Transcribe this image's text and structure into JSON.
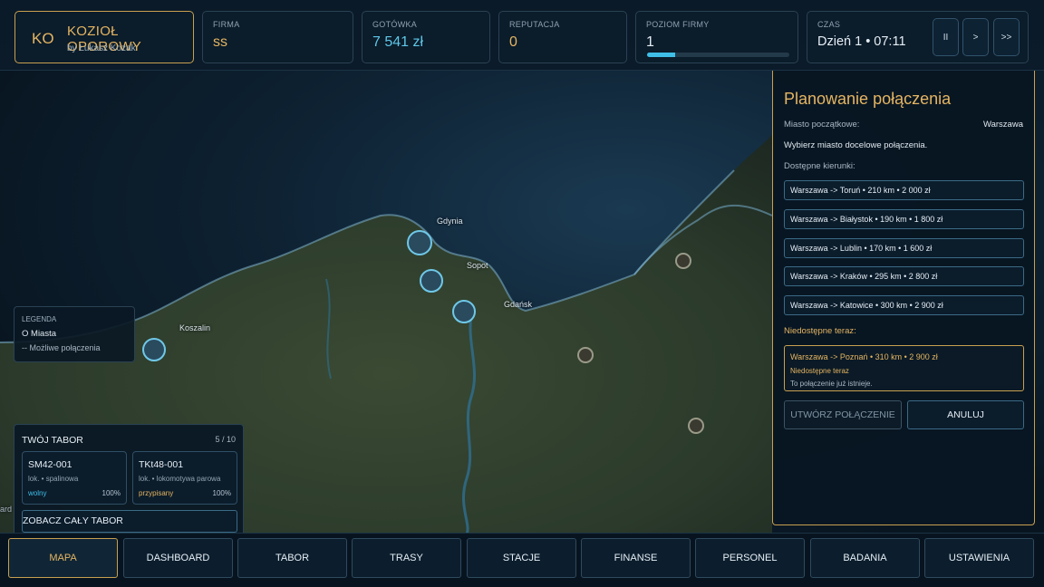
{
  "header": {
    "brand": {
      "initials": "KO",
      "name": "KOZIOŁ OPOROWY",
      "author": "by Łukasz Kozak"
    },
    "firma": {
      "label": "FIRMA",
      "value": "ss"
    },
    "gotowka": {
      "label": "GOTÓWKA",
      "value": "7 541 zł"
    },
    "reputacja": {
      "label": "REPUTACJA",
      "value": "0"
    },
    "poziom": {
      "label": "POZIOM FIRMY",
      "value": "1",
      "progress_percent": 20
    },
    "czas": {
      "label": "CZAS",
      "value": "Dzień 1 • 07:11"
    },
    "controls": {
      "pause": "II",
      "play": ">",
      "fast": ">>"
    }
  },
  "map": {
    "cities": [
      "Gdynia",
      "Sopot",
      "Gdańsk",
      "Koszalin"
    ],
    "edge_fragment": "ard"
  },
  "legend": {
    "title": "LEGENDA",
    "cities": "O Miasta",
    "connections": "-- Możliwe połączenia"
  },
  "fleet": {
    "title": "TWÓJ TABOR",
    "count": "5 / 10",
    "cards": [
      {
        "name": "SM42-001",
        "type": "lok. • spalinowa",
        "status": "wolny",
        "condition": "100%"
      },
      {
        "name": "TKt48-001",
        "type": "lok. • lokomotywa parowa",
        "status": "przypisany",
        "condition": "100%"
      }
    ],
    "see_all": "ZOBACZ CAŁY TABOR"
  },
  "planner": {
    "title": "Planowanie połączenia",
    "start_label": "Miasto początkowe:",
    "start_value": "Warszawa",
    "instruction": "Wybierz miasto docelowe połączenia.",
    "directions_label": "Dostępne kierunki:",
    "routes": [
      "Warszawa -> Toruń • 210 km • 2 000 zł",
      "Warszawa -> Białystok • 190 km • 1 800 zł",
      "Warszawa -> Lublin • 170 km • 1 600 zł",
      "Warszawa -> Kraków • 295 km • 2 800 zł",
      "Warszawa -> Katowice • 300 km • 2 900 zł"
    ],
    "unavailable_label": "Niedostępne teraz:",
    "unavailable": {
      "route": "Warszawa -> Poznań • 310 km • 2 900 zł",
      "status": "Niedostępne teraz",
      "reason": "To połączenie już istnieje."
    },
    "create_button": "UTWÓRZ POŁĄCZENIE",
    "cancel_button": "ANULUJ"
  },
  "nav": [
    "MAPA",
    "DASHBOARD",
    "TABOR",
    "TRASY",
    "STACJE",
    "FINANSE",
    "PERSONEL",
    "BADANIA",
    "USTAWIENIA"
  ],
  "colors": {
    "accent_gold": "#e5b562",
    "accent_cyan": "#5ec7e8",
    "status_free": "#3fbfe8",
    "status_assigned": "#e5b562"
  }
}
